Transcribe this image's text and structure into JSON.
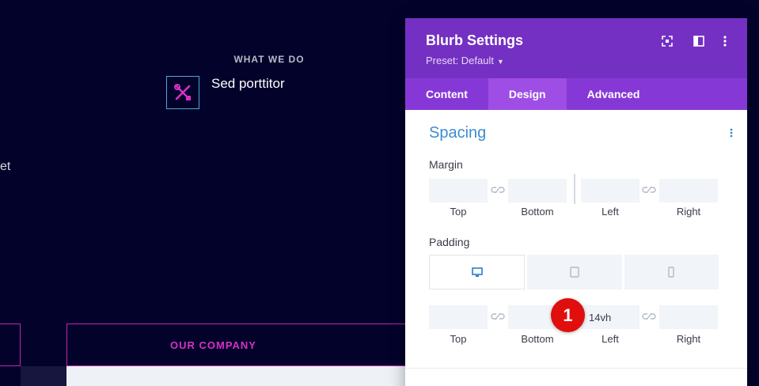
{
  "background": {
    "section_label": "WHAT WE DO",
    "blurb_title": "Sed porttitor",
    "cut_text": "et",
    "company_label": "OUR COMPANY"
  },
  "modal": {
    "title": "Blurb Settings",
    "preset": "Preset: Default",
    "tabs": [
      {
        "label": "Content",
        "active": false
      },
      {
        "label": "Design",
        "active": true
      },
      {
        "label": "Advanced",
        "active": false
      }
    ],
    "section_title": "Spacing",
    "margin": {
      "label": "Margin",
      "top": "",
      "bottom": "",
      "left": "",
      "right": "",
      "labels": {
        "top": "Top",
        "bottom": "Bottom",
        "left": "Left",
        "right": "Right"
      }
    },
    "padding": {
      "label": "Padding",
      "devices": [
        "desktop-icon",
        "tablet-icon",
        "phone-icon"
      ],
      "active_device": "desktop",
      "top": "",
      "bottom": "",
      "left": "14vh",
      "right": "",
      "labels": {
        "top": "Top",
        "bottom": "Bottom",
        "left": "Left",
        "right": "Right"
      }
    }
  },
  "annotation": {
    "step": "1"
  },
  "colors": {
    "header": "#7430c2",
    "tabs": "#8638d7",
    "tab_active": "#9e4ee5",
    "section_title": "#3d8dd1",
    "accent_pink": "#d531c4",
    "badge": "#e10e0e"
  }
}
